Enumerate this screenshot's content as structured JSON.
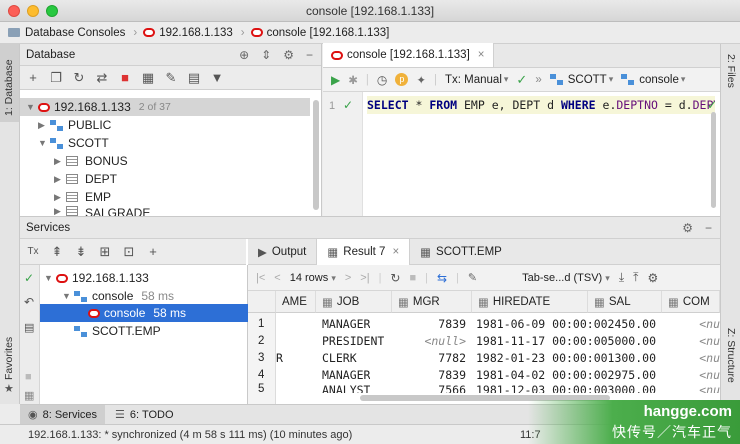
{
  "window": {
    "title": "console [192.168.1.133]"
  },
  "breadcrumb": [
    {
      "label": "Database Consoles",
      "icon": "folder-icon"
    },
    {
      "label": "192.168.1.133",
      "icon": "oracle-icon"
    },
    {
      "label": "console [192.168.1.133]",
      "icon": "oracle-icon"
    }
  ],
  "left_stripe": {
    "database_tab": "1: Database",
    "favorites_tab": "Favorites"
  },
  "right_stripe": {
    "files_tab": "2: Files",
    "structure_tab": "Z: Structure"
  },
  "database_panel": {
    "title": "Database",
    "tree": {
      "root": {
        "label": "192.168.1.133",
        "count": "2 of 37"
      },
      "schemas": [
        {
          "label": "PUBLIC",
          "expanded": false
        },
        {
          "label": "SCOTT",
          "expanded": true,
          "tables": [
            "BONUS",
            "DEPT",
            "EMP",
            "SALGRADE"
          ]
        }
      ]
    }
  },
  "editor": {
    "tab_label": "console [192.168.1.133]",
    "toolbar": {
      "tx_mode": "Tx: Manual",
      "schema": "SCOTT",
      "console": "console"
    },
    "line_number": "1",
    "sql": {
      "t1": "SELECT",
      "t2": "*",
      "t3": "FROM",
      "t4": "EMP e, DEPT d",
      "t5": "WHERE",
      "t6": "e.",
      "t7": "DEPTNO",
      "t8": "=",
      "t9": "d.",
      "t10": "DEPTNO",
      "t11": ";"
    }
  },
  "services": {
    "title": "Services",
    "tree": {
      "root": "192.168.1.133",
      "console_group": {
        "label": "console",
        "time": "58 ms"
      },
      "console_leaf": {
        "label": "console",
        "time": "58 ms"
      },
      "scott_emp": "SCOTT.EMP"
    },
    "result_tabs": {
      "output": "Output",
      "result": "Result 7",
      "scott_emp": "SCOTT.EMP"
    },
    "result_toolbar": {
      "rows": "14 rows",
      "export_format": "Tab-se...d (TSV)"
    },
    "grid": {
      "columns": [
        "AME",
        "JOB",
        "MGR",
        "HIREDATE",
        "SAL",
        "COM"
      ],
      "rows": [
        {
          "n": "1",
          "ename": "",
          "job": "MANAGER",
          "mgr": "7839",
          "hiredate": "1981-06-09 00:00:00",
          "sal": "2450.00",
          "comm": "<nu"
        },
        {
          "n": "2",
          "ename": "",
          "job": "PRESIDENT",
          "mgr": "<null>",
          "hiredate": "1981-11-17 00:00:00",
          "sal": "5000.00",
          "comm": "<nu"
        },
        {
          "n": "3",
          "ename": "R",
          "job": "CLERK",
          "mgr": "7782",
          "hiredate": "1982-01-23 00:00:00",
          "sal": "1300.00",
          "comm": "<nu"
        },
        {
          "n": "4",
          "ename": "",
          "job": "MANAGER",
          "mgr": "7839",
          "hiredate": "1981-04-02 00:00:00",
          "sal": "2975.00",
          "comm": "<nu"
        },
        {
          "n": "5",
          "ename": "",
          "job": "ANALYST",
          "mgr": "7566",
          "hiredate": "1981-12-03 00:00:00",
          "sal": "3000.00",
          "comm": "<nu"
        }
      ]
    }
  },
  "bottom_tabs": {
    "services": "8: Services",
    "todo": "6: TODO"
  },
  "status": {
    "message": "192.168.1.133: * synchronized (4 m 58 s 111 ms) (10 minutes ago)",
    "position": "11:7"
  },
  "watermark": {
    "line1": "hangge.com",
    "line2": "快传号／汽车正气"
  },
  "colors": {
    "selection": "#2d6fd6",
    "oracle_red": "#d11111",
    "run_green": "#3aa34a"
  }
}
